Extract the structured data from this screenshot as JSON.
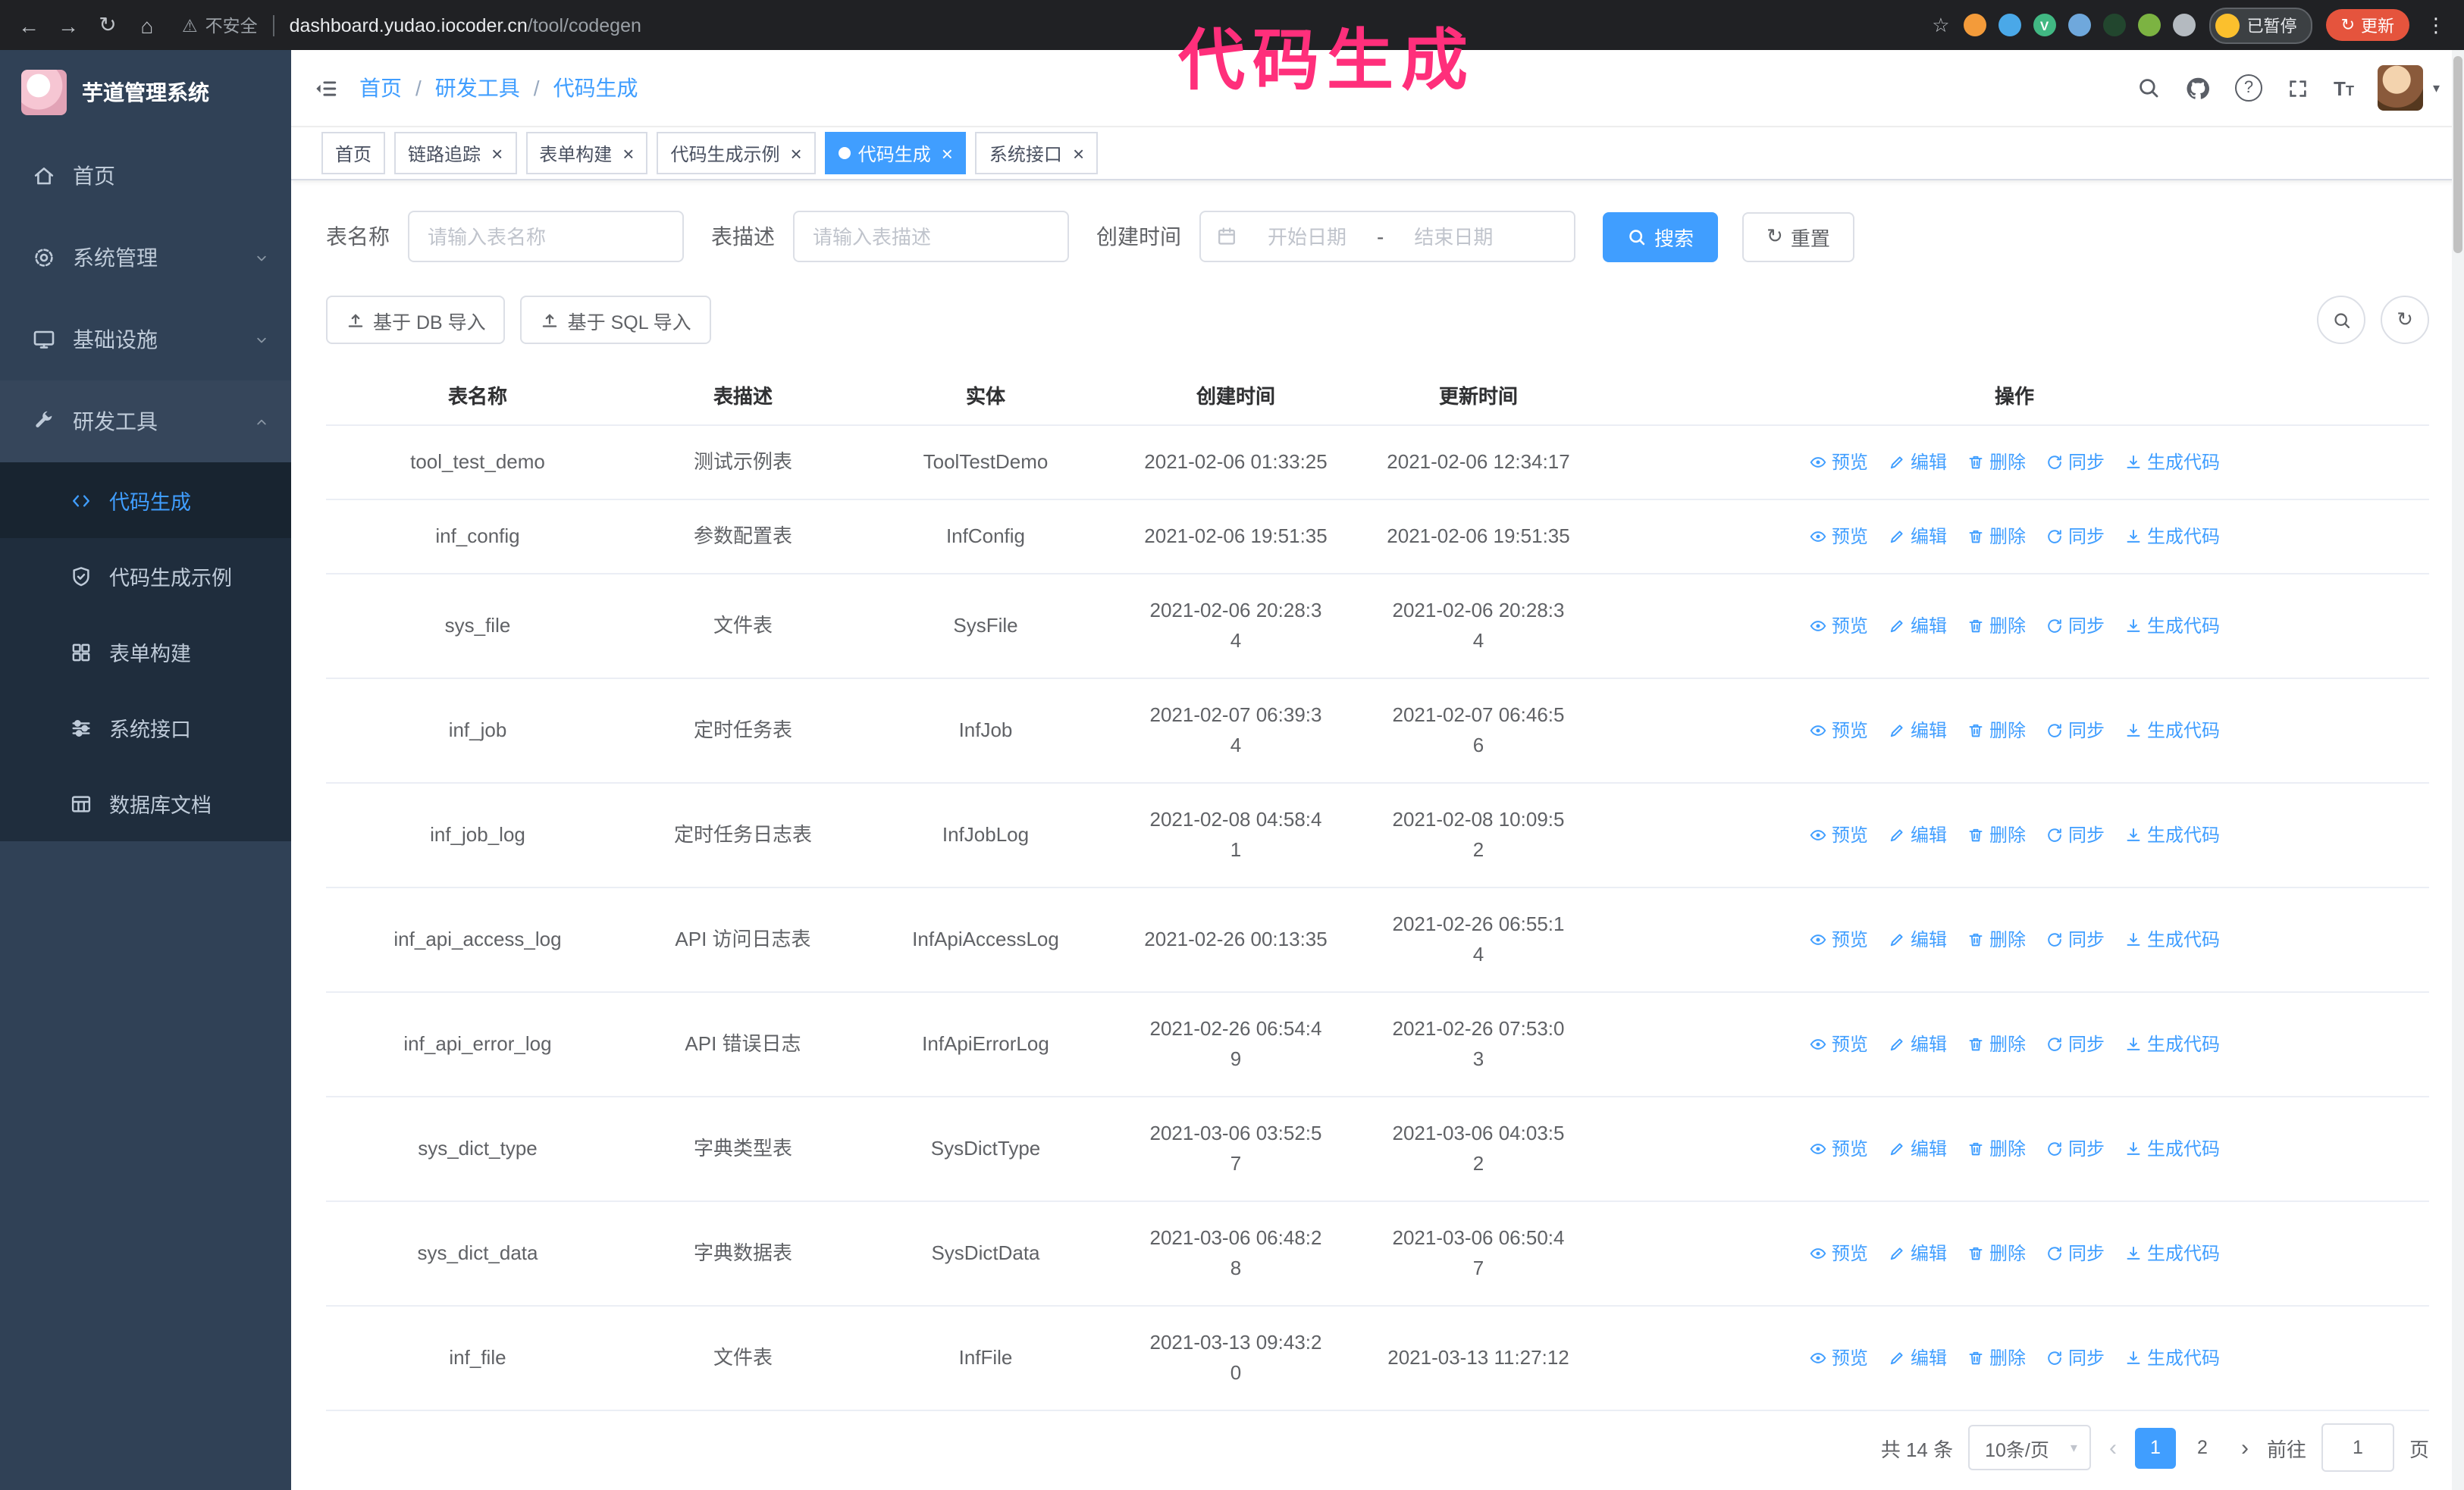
{
  "colors": {
    "primary": "#409EFF",
    "sidebar_bg": "#304156",
    "submenu_bg": "#1f2d3d",
    "annotation": "#ff2f7b",
    "update_btn": "#e5543d"
  },
  "browser": {
    "security_label": "不安全",
    "url_host": "dashboard.yudao.iocoder.cn",
    "url_path": "/tool/codegen",
    "paused_badge": "已暂停",
    "update_button": "更新",
    "extensions": [
      {
        "name": "fox-extension-icon",
        "color": "#f39b3a",
        "letter": ""
      },
      {
        "name": "drop-extension-icon",
        "color": "#4aa8e8",
        "letter": ""
      },
      {
        "name": "vue-devtools-icon",
        "color": "#41b883",
        "letter": "V"
      },
      {
        "name": "users-extension-icon",
        "color": "#6fa8dc",
        "letter": ""
      },
      {
        "name": "dark-extension-icon",
        "color": "#22462e",
        "letter": ""
      },
      {
        "name": "leaf-extension-icon",
        "color": "#7cb342",
        "letter": ""
      },
      {
        "name": "puzzle-extension-icon",
        "color": "#b4bac0",
        "letter": ""
      }
    ]
  },
  "annotation": {
    "text": "代码生成"
  },
  "sidebar": {
    "logo_title": "芋道管理系统",
    "items": [
      {
        "id": "home",
        "label": "首页",
        "icon": "home-icon",
        "expandable": false,
        "expanded": false
      },
      {
        "id": "system",
        "label": "系统管理",
        "icon": "gear-icon",
        "expandable": true,
        "expanded": false
      },
      {
        "id": "infra",
        "label": "基础设施",
        "icon": "monitor-icon",
        "expandable": true,
        "expanded": false
      },
      {
        "id": "dev-tools",
        "label": "研发工具",
        "icon": "tools-icon",
        "expandable": true,
        "expanded": true
      }
    ],
    "submenu": [
      {
        "id": "codegen",
        "label": "代码生成",
        "icon": "code-icon",
        "active": true
      },
      {
        "id": "codegen-demo",
        "label": "代码生成示例",
        "icon": "shield-check-icon",
        "active": false
      },
      {
        "id": "form-builder",
        "label": "表单构建",
        "icon": "grid-icon",
        "active": false
      },
      {
        "id": "api",
        "label": "系统接口",
        "icon": "sliders-icon",
        "active": false
      },
      {
        "id": "db-doc",
        "label": "数据库文档",
        "icon": "table-grid-icon",
        "active": false
      }
    ]
  },
  "header": {
    "breadcrumb": [
      "首页",
      "研发工具",
      "代码生成"
    ]
  },
  "tabs": [
    {
      "label": "首页",
      "closable": false,
      "active": false
    },
    {
      "label": "链路追踪",
      "closable": true,
      "active": false
    },
    {
      "label": "表单构建",
      "closable": true,
      "active": false
    },
    {
      "label": "代码生成示例",
      "closable": true,
      "active": false
    },
    {
      "label": "代码生成",
      "closable": true,
      "active": true
    },
    {
      "label": "系统接口",
      "closable": true,
      "active": false
    }
  ],
  "filters": {
    "table_name_label": "表名称",
    "table_name_placeholder": "请输入表名称",
    "table_desc_label": "表描述",
    "table_desc_placeholder": "请输入表描述",
    "create_time_label": "创建时间",
    "date_start_placeholder": "开始日期",
    "date_separator": "-",
    "date_end_placeholder": "结束日期",
    "search_label": "搜索",
    "reset_label": "重置"
  },
  "toolbar": {
    "import_db": "基于 DB 导入",
    "import_sql": "基于 SQL 导入"
  },
  "table": {
    "columns": [
      "表名称",
      "表描述",
      "实体",
      "创建时间",
      "更新时间",
      "操作"
    ],
    "actions": [
      "预览",
      "编辑",
      "删除",
      "同步",
      "生成代码"
    ],
    "action_icons": [
      "eye-icon",
      "edit-icon",
      "delete-icon",
      "sync-icon",
      "download-icon"
    ],
    "action_names": [
      "preview",
      "edit",
      "delete",
      "sync",
      "generate-code"
    ],
    "rows": [
      {
        "name": "tool_test_demo",
        "desc": "测试示例表",
        "entity": "ToolTestDemo",
        "created": "2021-02-06 01:33:25",
        "updated": "2021-02-06 12:34:17"
      },
      {
        "name": "inf_config",
        "desc": "参数配置表",
        "entity": "InfConfig",
        "created": "2021-02-06 19:51:35",
        "updated": "2021-02-06 19:51:35"
      },
      {
        "name": "sys_file",
        "desc": "文件表",
        "entity": "SysFile",
        "created": "2021-02-06 20:28:3\n4",
        "updated": "2021-02-06 20:28:3\n4"
      },
      {
        "name": "inf_job",
        "desc": "定时任务表",
        "entity": "InfJob",
        "created": "2021-02-07 06:39:3\n4",
        "updated": "2021-02-07 06:46:5\n6"
      },
      {
        "name": "inf_job_log",
        "desc": "定时任务日志表",
        "entity": "InfJobLog",
        "created": "2021-02-08 04:58:4\n1",
        "updated": "2021-02-08 10:09:5\n2"
      },
      {
        "name": "inf_api_access_log",
        "desc": "API 访问日志表",
        "entity": "InfApiAccessLog",
        "created": "2021-02-26 00:13:35",
        "updated": "2021-02-26 06:55:1\n4"
      },
      {
        "name": "inf_api_error_log",
        "desc": "API 错误日志",
        "entity": "InfApiErrorLog",
        "created": "2021-02-26 06:54:4\n9",
        "updated": "2021-02-26 07:53:0\n3"
      },
      {
        "name": "sys_dict_type",
        "desc": "字典类型表",
        "entity": "SysDictType",
        "created": "2021-03-06 03:52:5\n7",
        "updated": "2021-03-06 04:03:5\n2"
      },
      {
        "name": "sys_dict_data",
        "desc": "字典数据表",
        "entity": "SysDictData",
        "created": "2021-03-06 06:48:2\n8",
        "updated": "2021-03-06 06:50:4\n7"
      },
      {
        "name": "inf_file",
        "desc": "文件表",
        "entity": "InfFile",
        "created": "2021-03-13 09:43:2\n0",
        "updated": "2021-03-13 11:27:12"
      }
    ]
  },
  "pagination": {
    "total_text": "共 14 条",
    "page_size": "10条/页",
    "pages": [
      "1",
      "2"
    ],
    "active_page": "1",
    "goto_label": "前往",
    "goto_value": "1",
    "goto_suffix": "页"
  }
}
